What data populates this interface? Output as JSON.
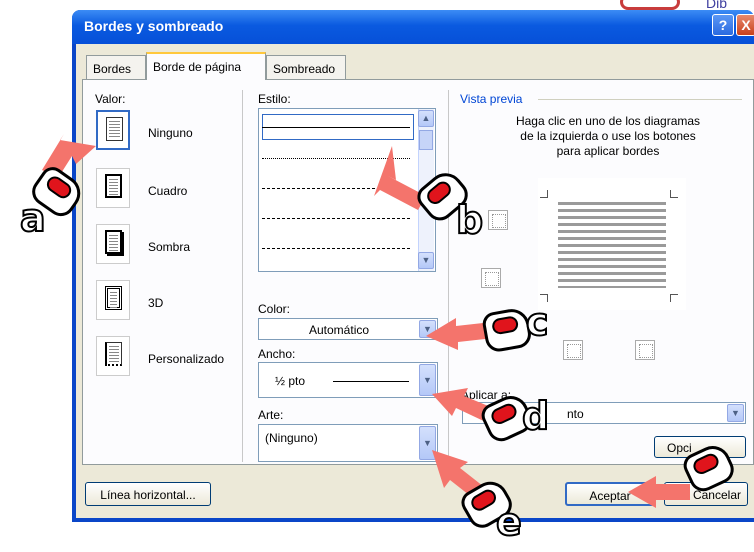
{
  "background": {
    "corner_text": "Dib"
  },
  "dialog": {
    "title": "Bordes y sombreado",
    "help_label": "?",
    "close_label": "X",
    "tabs": [
      {
        "label": "Bordes"
      },
      {
        "label": "Borde de página"
      },
      {
        "label": "Sombreado"
      }
    ],
    "setting": {
      "label": "Valor:",
      "options": [
        {
          "label": "Ninguno"
        },
        {
          "label": "Cuadro"
        },
        {
          "label": "Sombra"
        },
        {
          "label": "3D"
        },
        {
          "label": "Personalizado"
        }
      ]
    },
    "style": {
      "label": "Estilo:"
    },
    "color": {
      "label": "Color:",
      "value": "Automático"
    },
    "width": {
      "label": "Ancho:",
      "value": "½ pto"
    },
    "art": {
      "label": "Arte:",
      "value": "(Ninguno)"
    },
    "preview": {
      "label": "Vista previa",
      "instructions": "Haga clic en uno de los diagramas de la izquierda o use los botones para aplicar bordes"
    },
    "apply_to": {
      "label": "Aplicar a:",
      "value": "nto"
    },
    "buttons": {
      "horizontal_line": "Línea horizontal...",
      "options": "Opci",
      "ok": "Aceptar",
      "cancel": "Cancelar"
    }
  },
  "annotations": {
    "a": "a",
    "b": "b",
    "c": "c",
    "d": "d",
    "e": "e"
  },
  "colors": {
    "title_bar": "#0a5ae0",
    "client_bg": "#ece9d8",
    "arrow": "#f4746c",
    "tab_highlight": "#ffc83c"
  }
}
